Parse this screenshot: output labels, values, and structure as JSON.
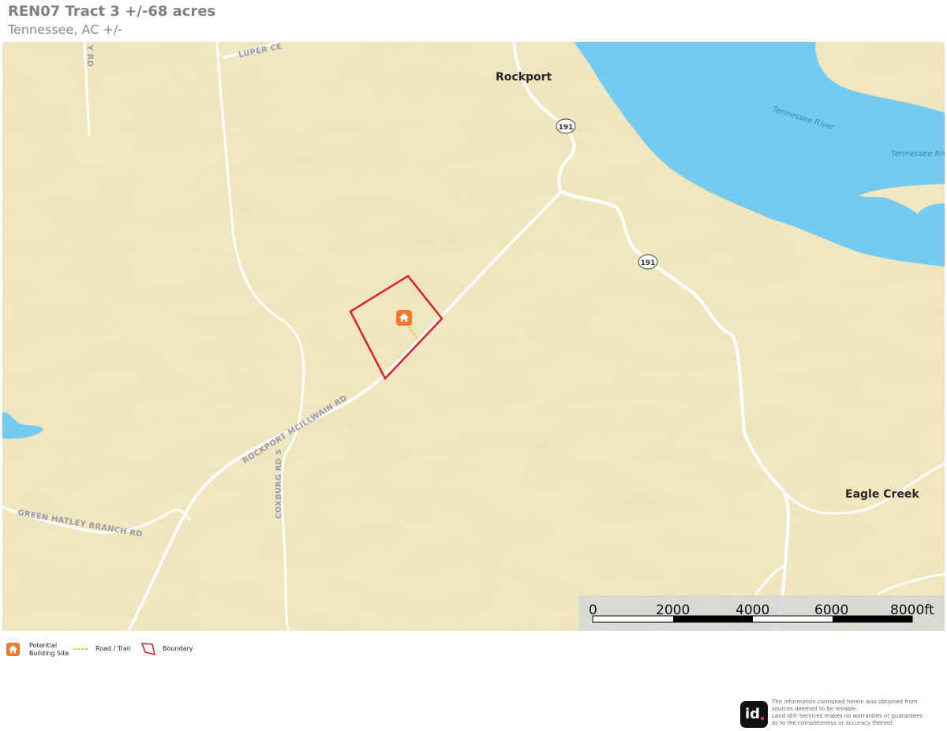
{
  "header": {
    "title": "REN07 Tract 3 +/-68 acres",
    "subtitle": "Tennessee,  AC +/-"
  },
  "map": {
    "colors": {
      "land": "#f0e6bf",
      "water": "#74cbef",
      "road": "#ffffff",
      "boundary": "#d9202e",
      "building_marker": "#f07a2b",
      "trail": "#f2c12e"
    },
    "places": {
      "rockport": "Rockport",
      "eagle_creek": "Eagle Creek"
    },
    "water_labels": {
      "river_1": "Tennessee River",
      "river_2": "Tennessee Riv"
    },
    "road_labels": {
      "rockport_mcillwain": "ROCKPORT MCILLWAIN RD",
      "coxburg": "COXBURG RD S",
      "green_hatley": "GREEN HATLEY BRANCH RD",
      "luper": "LUPER CE",
      "top_left": "Y RD"
    },
    "shields": {
      "north": "191",
      "south": "191"
    },
    "scale": {
      "labels": [
        "0",
        "2000",
        "4000",
        "6000",
        "8000ft"
      ]
    },
    "icons": {
      "building_site": "home-icon"
    }
  },
  "legend": {
    "building_site_line1": "Potential",
    "building_site_line2": "Building Site",
    "road_trail": "Road / Trail",
    "boundary": "Boundary"
  },
  "footer": {
    "logo_text": "id",
    "disclaimer_line1": "The information contained herein was obtained from",
    "disclaimer_line2": "sources deemed to be reliable.",
    "disclaimer_line3": " Land id® Services makes no warranties or guarantees",
    "disclaimer_line4": "as to the completeness or accuracy thereof."
  }
}
